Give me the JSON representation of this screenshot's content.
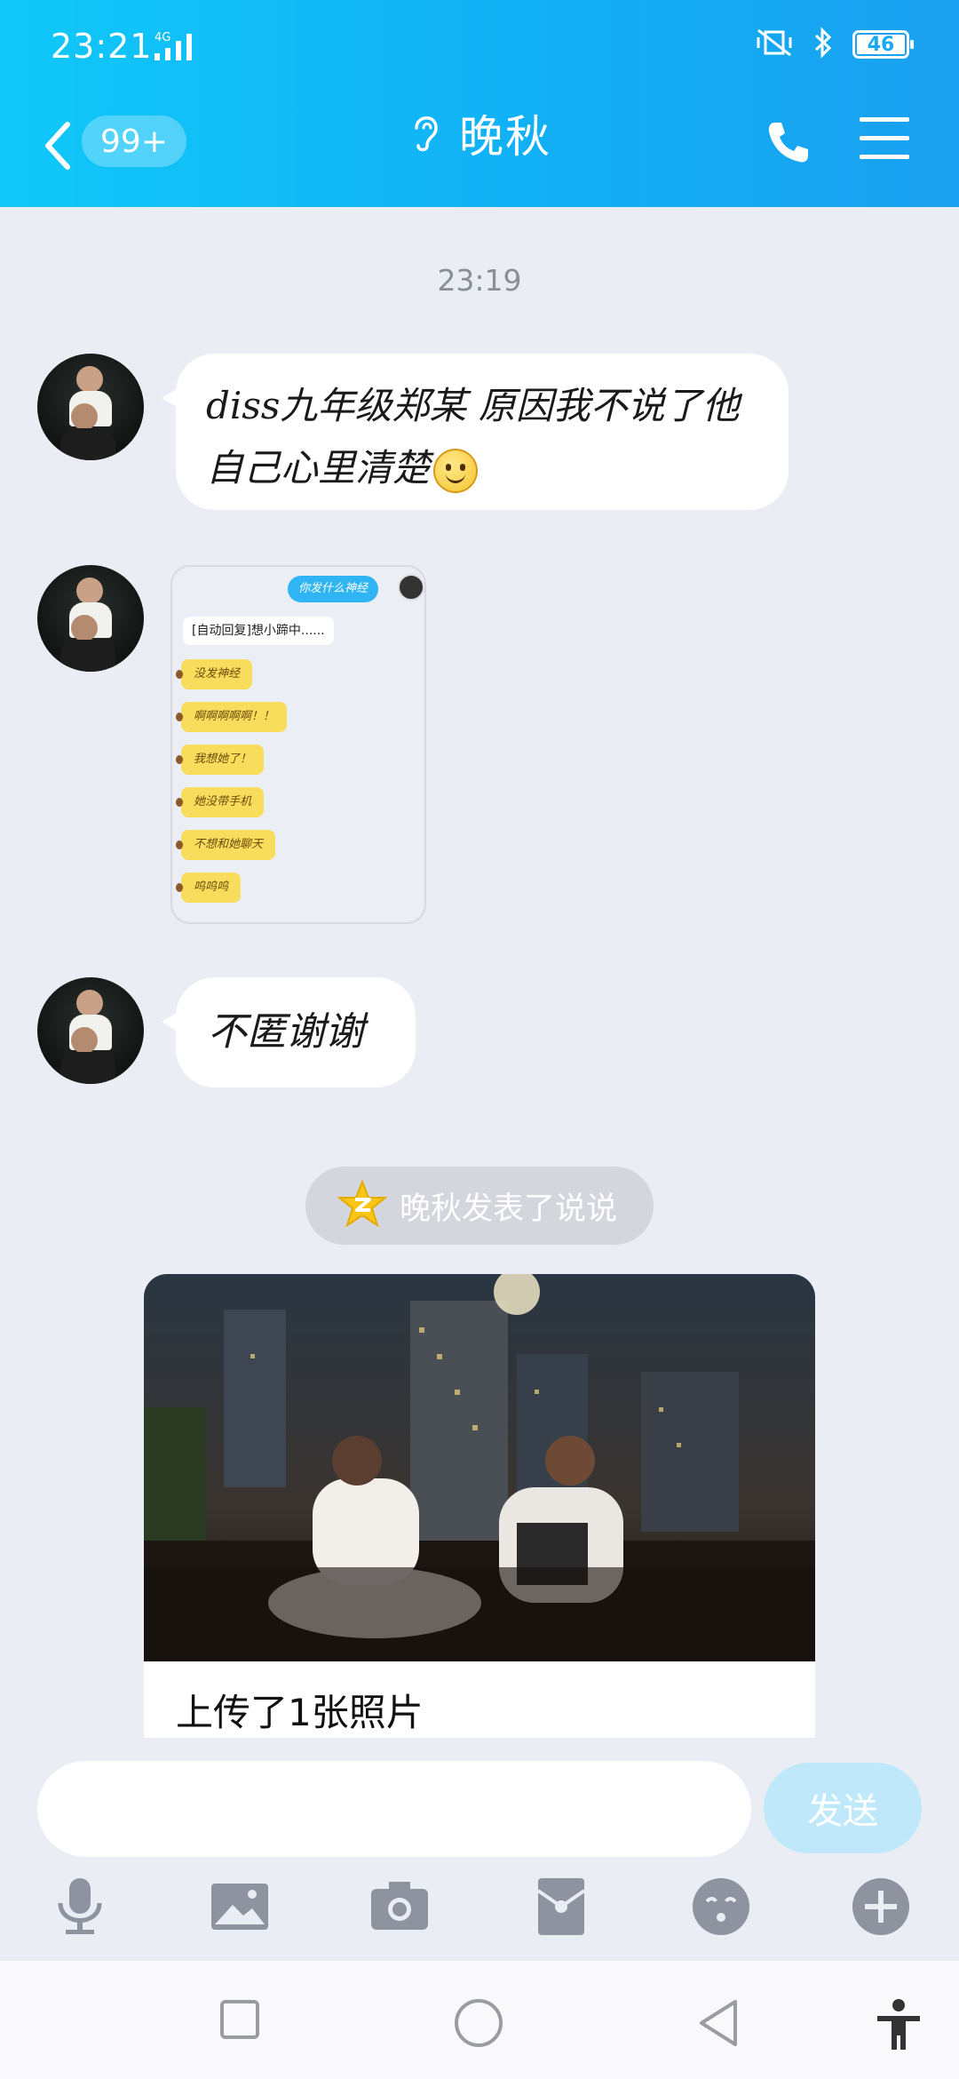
{
  "status_bar": {
    "time": "23:21",
    "network": "4G",
    "battery": "46"
  },
  "header": {
    "badge": "99+",
    "title": "晚秋"
  },
  "chat": {
    "timestamp": "23:19",
    "messages": [
      {
        "type": "text",
        "text": "diss九年级郑某 原因我不说了他自己心里清楚"
      },
      {
        "type": "image",
        "outgoing": "你发什么神经",
        "auto_reply": "[自动回复]想小蹄中......",
        "items": [
          "没发神经",
          "啊啊啊啊啊！！",
          "我想她了！",
          "她没带手机",
          "不想和她聊天",
          "呜呜呜"
        ]
      },
      {
        "type": "text",
        "text": "不匿谢谢"
      }
    ],
    "notice": "晚秋发表了说说",
    "post_caption": "上传了1张照片"
  },
  "input": {
    "value": "",
    "placeholder": "",
    "send_label": "发送"
  },
  "toolbar": {
    "tools": [
      "mic-icon",
      "image-icon",
      "camera-icon",
      "red-packet-icon",
      "emoji-icon",
      "plus-icon"
    ]
  },
  "colors": {
    "header_start": "#10c8f8",
    "header_end": "#1aa0f0",
    "background": "#eaedf4",
    "send_button": "#bfe9fb",
    "icon_gray": "#8e939f"
  }
}
